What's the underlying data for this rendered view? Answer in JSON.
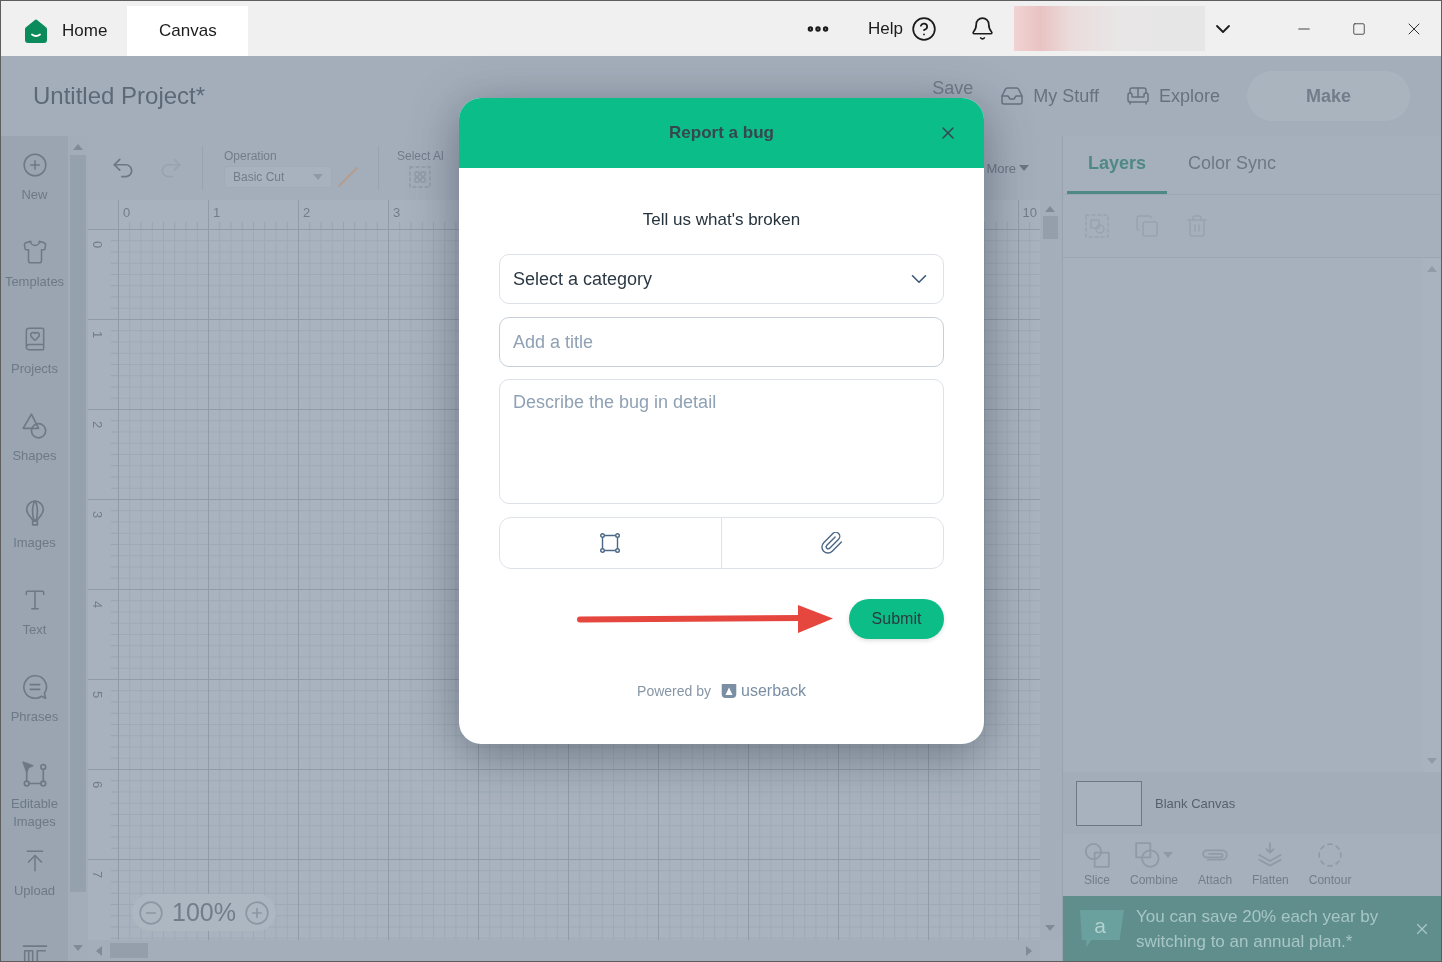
{
  "title_bar": {
    "tabs": [
      {
        "label": "Home",
        "selected": false
      },
      {
        "label": "Canvas",
        "selected": true
      }
    ],
    "help": "Help"
  },
  "header": {
    "project_title": "Untitled Project*",
    "links": [
      "Save",
      "My Stuff",
      "Explore"
    ],
    "make_button": {
      "label": "Make",
      "disabled": true
    }
  },
  "sidebar": {
    "items": [
      "New",
      "Templates",
      "Projects",
      "Shapes",
      "Images",
      "Text",
      "Phrases",
      "Editable Images",
      "Upload"
    ]
  },
  "canvas_toolbar": {
    "history": [
      {
        "disabled": false
      },
      {
        "disabled": true
      }
    ],
    "operation": {
      "label": "Operation",
      "value": "Basic Cut"
    },
    "select_all": "Select Al",
    "more": "More"
  },
  "rulers": {
    "horizontal": [
      "0",
      "1",
      "2",
      "3"
    ],
    "horizontal_end": "10",
    "vertical": [
      "0",
      "1",
      "2",
      "3",
      "4",
      "5",
      "6",
      "7"
    ]
  },
  "zoom": {
    "value": "100%"
  },
  "layers_panel": {
    "tabs": [
      {
        "label": "Layers",
        "selected": true
      },
      {
        "label": "Color Sync",
        "selected": false
      }
    ],
    "layers": [
      {
        "name": "Blank Canvas"
      }
    ],
    "tools": [
      {
        "label": "Slice",
        "disabled": true
      },
      {
        "label": "Combine",
        "disabled": true
      },
      {
        "label": "Attach",
        "disabled": true
      },
      {
        "label": "Flatten",
        "disabled": true
      },
      {
        "label": "Contour",
        "disabled": true
      }
    ]
  },
  "promo": {
    "logo": "a",
    "text": "You can save 20% each year by switching to an annual plan.*"
  },
  "dialog": {
    "title": "Report a bug",
    "prompt": "Tell us what's broken",
    "category": {
      "value": "Select a category"
    },
    "title_field": {
      "placeholder": "Add a title"
    },
    "description": {
      "placeholder": "Describe the bug in detail"
    },
    "submit": "Submit",
    "footer": {
      "powered_by": "Powered by",
      "brand": "userback"
    }
  }
}
